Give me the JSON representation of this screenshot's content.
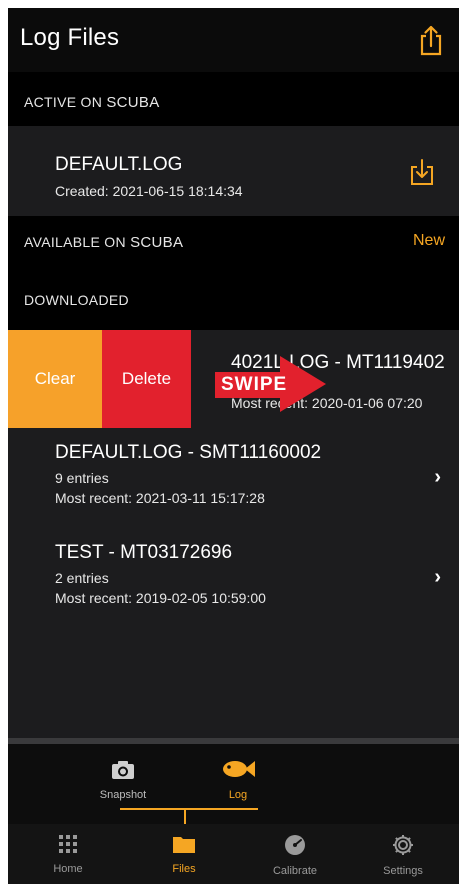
{
  "header": {
    "title": "Log Files",
    "share_icon": "share-icon"
  },
  "active_section": {
    "label_prefix": "ACTIVE ON",
    "label_device": "SCUBA",
    "file": {
      "name": "DEFAULT.LOG",
      "created": "Created: 2021-06-15 18:14:34",
      "icon": "download-icon"
    }
  },
  "available_section": {
    "label_prefix": "AVAILABLE ON",
    "label_device": "SCUBA",
    "new_label": "New"
  },
  "downloaded_section": {
    "label": "DOWNLOADED",
    "swiped_item": {
      "title": "4021L.LOG - MT1119402",
      "recent": "Most recent: 2020-01-06 07:20"
    },
    "swipe_actions": {
      "clear": "Clear",
      "delete": "Delete"
    },
    "swipe_tag": "SWIPE",
    "items": [
      {
        "title": "DEFAULT.LOG - SMT11160002",
        "entries": "9 entries",
        "recent": "Most recent: 2021-03-11 15:17:28"
      },
      {
        "title": "TEST - MT03172696",
        "entries": "2 entries",
        "recent": "Most recent: 2019-02-05 10:59:00"
      }
    ]
  },
  "subtabs": [
    {
      "label": "Snapshot",
      "icon": "camera-icon"
    },
    {
      "label": "Log",
      "icon": "fish-icon",
      "active": true
    }
  ],
  "tabbar": [
    {
      "label": "Home",
      "icon": "grid-icon"
    },
    {
      "label": "Files",
      "icon": "folder-icon",
      "active": true
    },
    {
      "label": "Calibrate",
      "icon": "gauge-icon"
    },
    {
      "label": "Settings",
      "icon": "gear-icon"
    }
  ],
  "colors": {
    "accent": "#f5a623",
    "delete": "#e2212d",
    "clear": "#f6a12a",
    "row": "#1c1c1e"
  }
}
